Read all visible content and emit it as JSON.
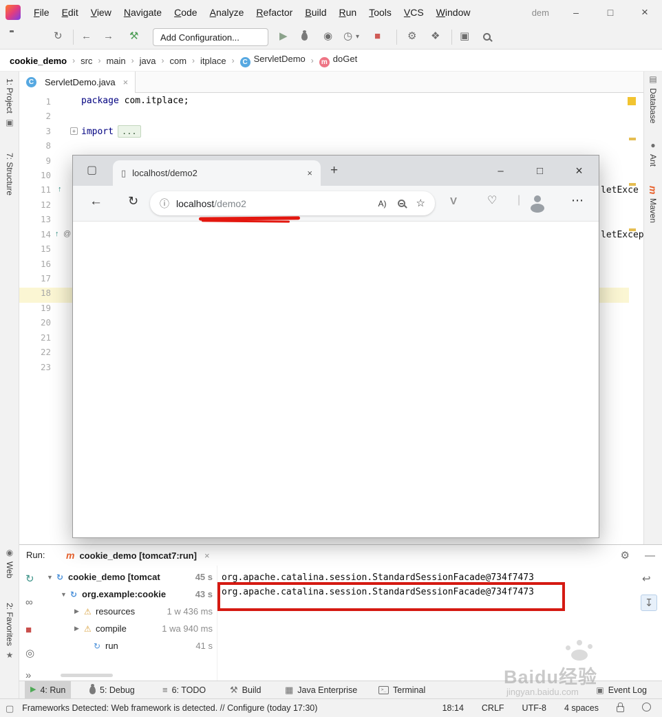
{
  "window": {
    "title_fragment": "dem"
  },
  "menu": {
    "items": [
      "File",
      "Edit",
      "View",
      "Navigate",
      "Code",
      "Analyze",
      "Refactor",
      "Build",
      "Run",
      "Tools",
      "VCS",
      "Window"
    ]
  },
  "toolbar": {
    "add_configuration": "Add Configuration..."
  },
  "breadcrumbs": {
    "separator": "›",
    "items": [
      "cookie_demo",
      "src",
      "main",
      "java",
      "com",
      "itplace",
      "ServletDemo",
      "doGet"
    ]
  },
  "left_stripe": {
    "project": "1: Project",
    "structure": "7: Structure",
    "web": "Web",
    "favorites": "2: Favorites"
  },
  "right_stripe": {
    "database": "Database",
    "ant": "Ant",
    "maven": "Maven"
  },
  "editor": {
    "tab_title": "ServletDemo.java",
    "class_badge": "C",
    "method_badge": "m",
    "line_numbers": [
      "1",
      "2",
      "3",
      "8",
      "9",
      "10",
      "11",
      "12",
      "13",
      "14",
      "15",
      "16",
      "17",
      "18",
      "19",
      "20",
      "21",
      "22",
      "23"
    ],
    "code": {
      "line1_keyword": "package",
      "line1_rest": " com.itplace;",
      "line3_keyword": "import",
      "fold_text": "...",
      "fragment_line11": "letExce",
      "fragment_line14": "letExcep"
    }
  },
  "browser": {
    "tab_title": "localhost/demo2",
    "url_host": "localhost",
    "url_path": "/demo2"
  },
  "run": {
    "label": "Run:",
    "maven_badge": "m",
    "tab_title": "cookie_demo [tomcat7:run]",
    "tree": [
      {
        "label": "cookie_demo [tomcat",
        "time": "45 s"
      },
      {
        "label": "org.example:cookie",
        "time": "43 s"
      },
      {
        "label": "resources",
        "time": "1 w 436 ms"
      },
      {
        "label": "compile",
        "time": "1 wa 940 ms"
      },
      {
        "label": "run",
        "time": "41 s"
      }
    ],
    "console_lines": [
      "org.apache.catalina.session.StandardSessionFacade@734f7473",
      "org.apache.catalina.session.StandardSessionFacade@734f7473"
    ]
  },
  "bottom_bar": {
    "run": "4: Run",
    "debug": "5: Debug",
    "todo": "6: TODO",
    "build": "Build",
    "java_enterprise": "Java Enterprise",
    "terminal": "Terminal",
    "terminal_glyph": ">_",
    "event_log": "Event Log"
  },
  "status_bar": {
    "message": "Frameworks Detected: Web framework is detected. // Configure (today 17:30)",
    "time": "18:14",
    "line_ending": "CRLF",
    "encoding": "UTF-8",
    "indent": "4 spaces"
  },
  "watermark": {
    "line1": "Baidu经验",
    "line2": "jingyan.baidu.com"
  },
  "colors": {
    "annotation_red": "#d51a12",
    "keyword_blue": "#000080",
    "warning_yellow": "#d9a23f",
    "maven_orange": "#e8612c",
    "class_icon_blue": "#56a8e1",
    "method_icon_pink": "#ee7585"
  },
  "icons": {
    "minimize": "–",
    "maximize": "□",
    "close": "×",
    "back": "←",
    "forward": "→",
    "sync": "↻",
    "run": "▶",
    "stop": "■",
    "dropdown": "▾",
    "coverage": "◉",
    "profiler": "◷",
    "wrench": "⚙",
    "structure": "❖",
    "layout": "▣",
    "gear": "⚙",
    "hide": "—",
    "expand_open": "▼",
    "expand_closed": "▶",
    "warning": "⚠",
    "spinner": "↻",
    "rerun": "↻",
    "chevrons": "»",
    "more": "⋯",
    "plus": "+",
    "info": "ⓘ",
    "read_aloud": "A)",
    "star_add": "☆",
    "star_filled": "★",
    "tab_square": "▢",
    "page": "▯",
    "letter_v": "V",
    "essentials": "♡",
    "divider": "|",
    "override": "↑",
    "at": "@",
    "todo": "≡",
    "hammer": "⚒",
    "grid": "▦",
    "db": "▤",
    "web": "◉",
    "ant_dot": "●",
    "soft_wrap": "↩",
    "scroll_end": "↧",
    "eye": "◎",
    "glasses": "∞",
    "event": "▣",
    "toggle_window": "▢"
  }
}
